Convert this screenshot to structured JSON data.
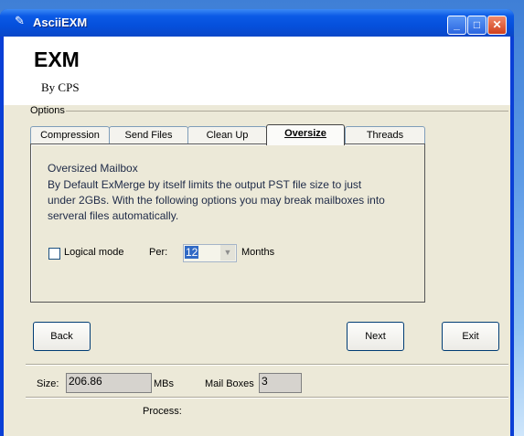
{
  "window": {
    "title": "AsciiEXM",
    "icon": "app-icon"
  },
  "header": {
    "title": "EXM",
    "byline": "By CPS"
  },
  "options": {
    "label": "Options"
  },
  "tabs": [
    {
      "label": "Compression"
    },
    {
      "label": "Send Files"
    },
    {
      "label": "Clean Up"
    },
    {
      "label": "Oversize",
      "selected": true
    },
    {
      "label": "Threads"
    }
  ],
  "panel": {
    "heading": "Oversized Mailbox",
    "description": "By Default ExMerge by itself limits the output PST file size to just under 2GBs.  With the following options you may break mailboxes into serveral files automatically.",
    "logical_mode_label": "Logical mode",
    "logical_mode_checked": false,
    "per_label": "Per:",
    "per_value": "12",
    "months_label": "Months"
  },
  "buttons": {
    "back": "Back",
    "next": "Next",
    "exit": "Exit"
  },
  "status": {
    "size_label": "Size:",
    "size_value": "206.86",
    "size_unit": "MBs",
    "mailboxes_label": "Mail Boxes",
    "mailboxes_value": "3",
    "process_label": "Process:"
  },
  "colors": {
    "titlebar": "#0550dc",
    "panel_bg": "#ece9d8",
    "selection": "#316ac5"
  }
}
